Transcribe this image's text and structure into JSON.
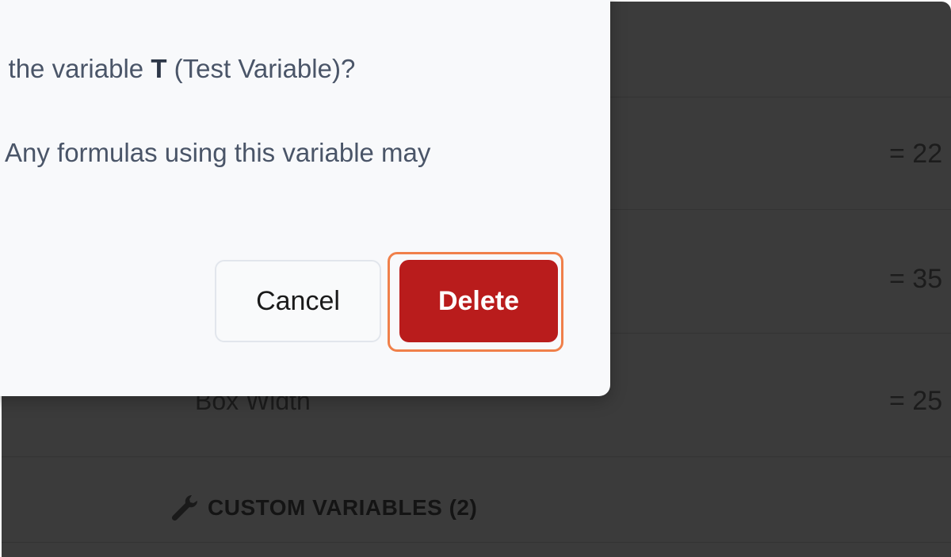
{
  "dialog": {
    "question_prefix": "e the variable ",
    "variable_symbol": "T",
    "question_suffix": " (Test Variable)?",
    "warning_text": "Any formulas using this variable may",
    "cancel_label": "Cancel",
    "delete_label": "Delete"
  },
  "background": {
    "values": [
      "= 22",
      "= 35",
      "= 25"
    ],
    "partial_label": "Box Width",
    "section_header": "CUSTOM VARIABLES (2)",
    "section_icon": "wrench-icon"
  },
  "colors": {
    "delete_button": "#b91c1c",
    "focus_ring": "#f0804a",
    "backdrop": "#3b3b3b",
    "modal_bg": "#f8f9fb"
  }
}
